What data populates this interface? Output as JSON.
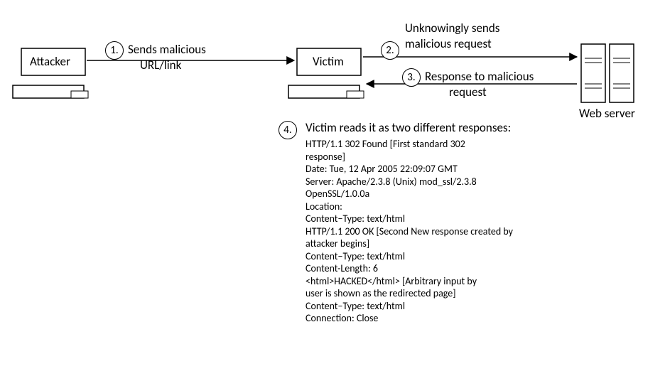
{
  "nodes": {
    "attacker": "Attacker",
    "victim": "Victim",
    "webserver": "Web server"
  },
  "steps": {
    "s1_line1": "Sends malicious",
    "s1_line2": "URL/link",
    "s2_line1": "Unknowingly sends",
    "s2_line2": "malicious request",
    "s3_line1": "Response to malicious",
    "s3_line2": "request",
    "s4_title": "Victim reads it as two different\nresponses:"
  },
  "nums": {
    "n1": "1.",
    "n2": "2.",
    "n3": "3.",
    "n4": "4."
  },
  "http": {
    "l01": "HTTP/1.1 302  Found [First standard 302",
    "l02": "response]",
    "l03": "Date: Tue, 12  Apr 2005  22:09:07  GMT",
    "l04": "Server: Apache/2.3.8 (Unix) mod_ssl/2.3.8",
    "l05": "OpenSSL/1.0.0a",
    "l06": "Location:",
    "l07": "Content−Type: text/html",
    "l08": "HTTP/1.1 200  OK [Second New response created by",
    "l09": "attacker begins]",
    "l10": "Content−Type: text/html",
    "l11": "Content-Length: 6",
    "l12": "<html>HACKED</html> [Arbitrary input by",
    "l13": "user is shown as the redirected page]",
    "l14": "Content−Type: text/html",
    "l15": "Connection: Close"
  }
}
